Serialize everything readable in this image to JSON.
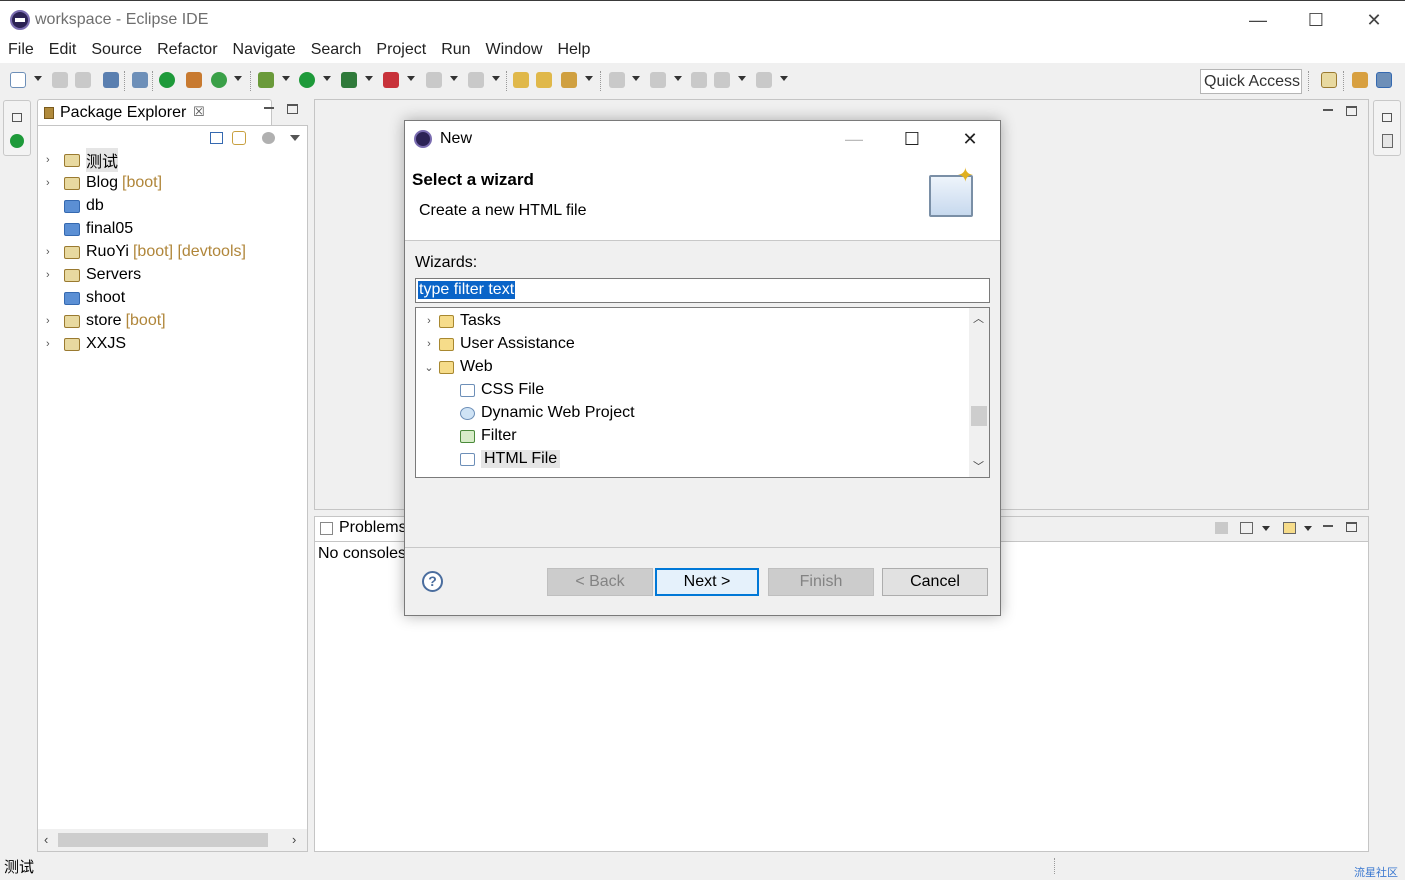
{
  "window": {
    "title": "workspace - Eclipse IDE",
    "minimize": "—",
    "maximize": "☐",
    "close": "✕"
  },
  "menu": [
    "File",
    "Edit",
    "Source",
    "Refactor",
    "Navigate",
    "Search",
    "Project",
    "Run",
    "Window",
    "Help"
  ],
  "quick_access": "Quick Access",
  "package_explorer": {
    "tab_label": "Package Explorer",
    "tab_close": "☒",
    "items": [
      {
        "name": "测试",
        "decoration": "",
        "expandable": true,
        "icon": "project-icon",
        "selected": true
      },
      {
        "name": "Blog",
        "decoration": "[boot]",
        "expandable": true,
        "icon": "project-icon"
      },
      {
        "name": "db",
        "decoration": "",
        "expandable": false,
        "icon": "folder-icon"
      },
      {
        "name": "final05",
        "decoration": "",
        "expandable": false,
        "icon": "folder-icon"
      },
      {
        "name": "RuoYi",
        "decoration": "[boot] [devtools]",
        "expandable": true,
        "icon": "project-icon"
      },
      {
        "name": "Servers",
        "decoration": "",
        "expandable": true,
        "icon": "project-icon"
      },
      {
        "name": "shoot",
        "decoration": "",
        "expandable": false,
        "icon": "folder-icon"
      },
      {
        "name": "store",
        "decoration": "[boot]",
        "expandable": true,
        "icon": "project-icon"
      },
      {
        "name": "XXJS",
        "decoration": "",
        "expandable": true,
        "icon": "project-icon"
      }
    ]
  },
  "console": {
    "tab_label": "Problems",
    "message": "No consoles"
  },
  "status": {
    "text": "测试",
    "watermark": "流星社区"
  },
  "dialog": {
    "title": "New",
    "heading": "Select a wizard",
    "description": "Create a new HTML file",
    "wizards_label": "Wizards:",
    "filter_placeholder": "type filter text",
    "tree": [
      {
        "name": "Tasks",
        "level": 0,
        "expanded": false,
        "type": "folder"
      },
      {
        "name": "User Assistance",
        "level": 0,
        "expanded": false,
        "type": "folder"
      },
      {
        "name": "Web",
        "level": 0,
        "expanded": true,
        "type": "folder"
      },
      {
        "name": "CSS File",
        "level": 1,
        "type": "file"
      },
      {
        "name": "Dynamic Web Project",
        "level": 1,
        "type": "file"
      },
      {
        "name": "Filter",
        "level": 1,
        "type": "file"
      },
      {
        "name": "HTML File",
        "level": 1,
        "type": "file",
        "selected": true
      }
    ],
    "buttons": {
      "back": "< Back",
      "next": "Next >",
      "finish": "Finish",
      "cancel": "Cancel",
      "help": "?"
    }
  }
}
